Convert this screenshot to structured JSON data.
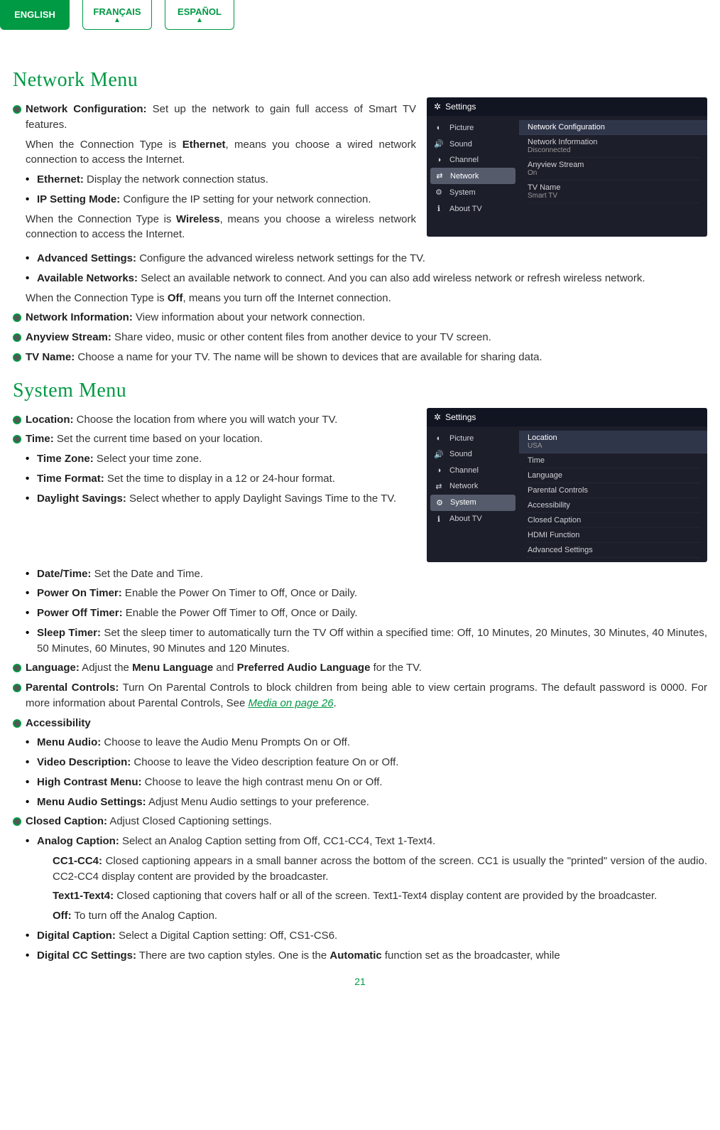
{
  "tabs": {
    "english": "ENGLISH",
    "francais": "FRANÇAIS",
    "espanol": "ESPAÑOL"
  },
  "sections": {
    "network": "Network Menu",
    "system": "System Menu"
  },
  "network": {
    "conf": {
      "t": "Network Configuration:",
      "d": " Set up the network to gain full access of Smart TV features."
    },
    "ethIntro1": "When the Connection Type is ",
    "ethBold": "Ethernet",
    "ethIntro2": ", means you choose a wired network connection to access the Internet.",
    "ethernet": {
      "t": "Ethernet:",
      "d": " Display the network connection status."
    },
    "ip": {
      "t": "IP Setting Mode:",
      "d": " Configure the IP setting for your network connection."
    },
    "wIntro1": "When the Connection Type is ",
    "wBold": "Wireless",
    "wIntro2": ", means you choose a wireless network connection to access the Internet.",
    "adv": {
      "t": "Advanced Settings:",
      "d": " Configure the advanced wireless network settings for the TV."
    },
    "avail": {
      "t": "Available Networks:",
      "d": " Select an available network to connect. And you can also add wireless network or refresh wireless network."
    },
    "off1": "When the Connection Type is ",
    "offBold": "Off",
    "off2": ", means you turn off the Internet connection.",
    "info": {
      "t": "Network Information:",
      "d": " View information about your network connection."
    },
    "any": {
      "t": "Anyview Stream:",
      "d": " Share video, music or other content files from another device to your TV screen."
    },
    "tvname": {
      "t": "TV Name:",
      "d": " Choose a name for your TV. The name will be shown to devices that are available for sharing data."
    }
  },
  "system": {
    "loc": {
      "t": "Location:",
      "d": " Choose the location from where you will watch your TV."
    },
    "time": {
      "t": "Time:",
      "d": " Set the current time based on your location."
    },
    "tz": {
      "t": "Time Zone:",
      "d": " Select your time zone."
    },
    "tf": {
      "t": "Time Format:",
      "d": " Set the time to display in a 12 or 24-hour format."
    },
    "ds": {
      "t": "Daylight Savings:",
      "d": " Select whether to apply Daylight Savings Time to the TV."
    },
    "dt": {
      "t": "Date/Time:",
      "d": " Set the Date and Time."
    },
    "pon": {
      "t": "Power On Timer:",
      "d": " Enable the Power On Timer to Off, Once or Daily."
    },
    "poff": {
      "t": "Power Off Timer:",
      "d": " Enable the Power Off Timer to Off, Once or Daily."
    },
    "sleep": {
      "t": "Sleep Timer:",
      "d": " Set the sleep timer to automatically turn the TV Off within a specified time: Off, 10 Minutes, 20 Minutes, 30 Minutes, 40 Minutes, 50 Minutes, 60 Minutes, 90 Minutes and 120 Minutes."
    },
    "lang": {
      "t": "Language:",
      "d1": " Adjust the ",
      "b1": "Menu Language",
      "d2": " and ",
      "b2": "Preferred Audio Language",
      "d3": " for the TV."
    },
    "pc": {
      "t": "Parental Controls:",
      "d1": " Turn On Parental Controls to block children from being able to view certain programs. The default password is 0000. For more information about Parental Controls, See ",
      "link": "Media on page 26",
      "d2": "."
    },
    "acc": {
      "t": "Accessibility"
    },
    "ma": {
      "t": "Menu Audio:",
      "d": " Choose to leave the Audio Menu Prompts On or Off."
    },
    "vd": {
      "t": "Video Description:",
      "d": " Choose to leave the Video description feature On or Off."
    },
    "hc": {
      "t": "High Contrast Menu:",
      "d": " Choose to leave the high contrast menu On or Off."
    },
    "mas": {
      "t": "Menu Audio Settings:",
      "d": " Adjust Menu Audio settings to your preference."
    },
    "cc": {
      "t": "Closed Caption:",
      "d": " Adjust Closed Captioning settings."
    },
    "ac": {
      "t": "Analog Caption:",
      "d": " Select an Analog Caption setting from Off, CC1-CC4, Text 1-Text4."
    },
    "cc14": {
      "t": "CC1-CC4:",
      "d": " Closed captioning appears in a small banner across the bottom of the screen. CC1 is usually the \"printed\" version of the audio. CC2-CC4 display content are provided by the broadcaster."
    },
    "tx14": {
      "t": "Text1-Text4:",
      "d": " Closed captioning that covers half or all of the screen. Text1-Text4 display content are provided by the broadcaster."
    },
    "offcc": {
      "t": "Off:",
      "d": " To turn off the Analog Caption."
    },
    "dc": {
      "t": "Digital Caption:",
      "d": " Select a Digital Caption setting: Off, CS1-CS6."
    },
    "dccs": {
      "t": "Digital CC Settings:",
      "d1": " There are two caption styles. One is the ",
      "b1": "Automatic",
      "d2": " function set as the broadcaster, while"
    }
  },
  "panel": {
    "title": "Settings",
    "menu": [
      "Picture",
      "Sound",
      "Channel",
      "Network",
      "System",
      "About TV"
    ],
    "net": {
      "r1": "Network Configuration",
      "r2": "Network Information",
      "r2s": "Disconnected",
      "r3": "Anyview Stream",
      "r3s": "On",
      "r4": "TV Name",
      "r4s": "Smart TV"
    },
    "sys": {
      "r1": "Location",
      "r1s": "USA",
      "r2": "Time",
      "r3": "Language",
      "r4": "Parental Controls",
      "r5": "Accessibility",
      "r6": "Closed Caption",
      "r7": "HDMI Function",
      "r8": "Advanced Settings"
    }
  },
  "page": "21"
}
